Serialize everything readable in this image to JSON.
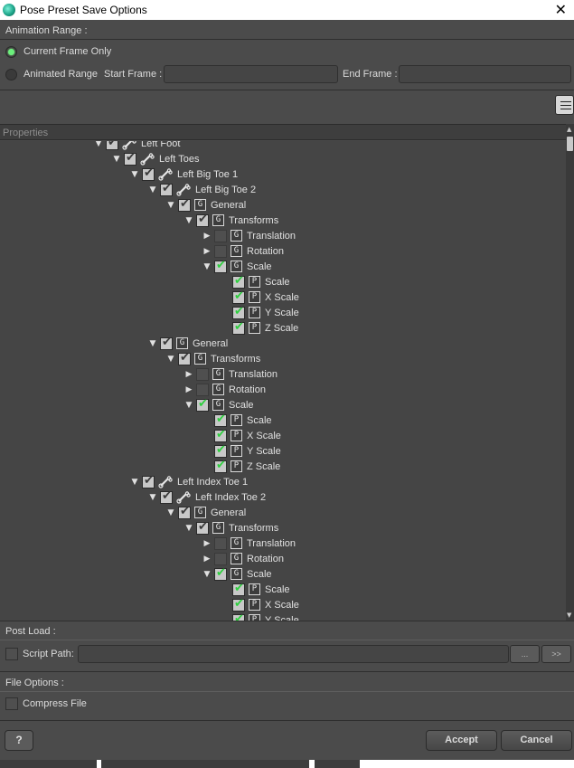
{
  "window": {
    "title": "Pose Preset Save Options",
    "close_glyph": "✕"
  },
  "animation_range": {
    "group_label": "Animation Range :",
    "current_frame_label": "Current Frame Only",
    "animated_range_label": "Animated Range",
    "start_frame_label": "Start Frame :",
    "end_frame_label": "End Frame :",
    "start_frame_value": "",
    "end_frame_value": ""
  },
  "properties": {
    "header": "Properties",
    "rows": [
      {
        "indent": 0,
        "arrow": "down",
        "check": "on",
        "icon": "bone",
        "label": "Left Foot"
      },
      {
        "indent": 1,
        "arrow": "down",
        "check": "on",
        "icon": "bone",
        "label": "Left Toes"
      },
      {
        "indent": 2,
        "arrow": "down",
        "check": "on",
        "icon": "bone",
        "label": "Left Big Toe 1"
      },
      {
        "indent": 3,
        "arrow": "down",
        "check": "on",
        "icon": "bone",
        "label": "Left Big Toe 2"
      },
      {
        "indent": 4,
        "arrow": "down",
        "check": "on",
        "icon": "G",
        "label": "General"
      },
      {
        "indent": 5,
        "arrow": "down",
        "check": "on",
        "icon": "G",
        "label": "Transforms"
      },
      {
        "indent": 6,
        "arrow": "right",
        "check": "off",
        "icon": "G",
        "label": "Translation"
      },
      {
        "indent": 6,
        "arrow": "right",
        "check": "off",
        "icon": "G",
        "label": "Rotation"
      },
      {
        "indent": 6,
        "arrow": "down",
        "check": "green",
        "icon": "G",
        "label": "Scale"
      },
      {
        "indent": 7,
        "arrow": "",
        "check": "green",
        "icon": "P",
        "label": "Scale"
      },
      {
        "indent": 7,
        "arrow": "",
        "check": "green",
        "icon": "P",
        "label": "X Scale"
      },
      {
        "indent": 7,
        "arrow": "",
        "check": "green",
        "icon": "P",
        "label": "Y Scale"
      },
      {
        "indent": 7,
        "arrow": "",
        "check": "green",
        "icon": "P",
        "label": "Z Scale"
      },
      {
        "indent": 3,
        "arrow": "down",
        "check": "on",
        "icon": "G",
        "label": "General"
      },
      {
        "indent": 4,
        "arrow": "down",
        "check": "on",
        "icon": "G",
        "label": "Transforms"
      },
      {
        "indent": 5,
        "arrow": "right",
        "check": "off",
        "icon": "G",
        "label": "Translation"
      },
      {
        "indent": 5,
        "arrow": "right",
        "check": "off",
        "icon": "G",
        "label": "Rotation"
      },
      {
        "indent": 5,
        "arrow": "down",
        "check": "green",
        "icon": "G",
        "label": "Scale"
      },
      {
        "indent": 6,
        "arrow": "",
        "check": "green",
        "icon": "P",
        "label": "Scale"
      },
      {
        "indent": 6,
        "arrow": "",
        "check": "green",
        "icon": "P",
        "label": "X Scale"
      },
      {
        "indent": 6,
        "arrow": "",
        "check": "green",
        "icon": "P",
        "label": "Y Scale"
      },
      {
        "indent": 6,
        "arrow": "",
        "check": "green",
        "icon": "P",
        "label": "Z Scale"
      },
      {
        "indent": 2,
        "arrow": "down",
        "check": "on",
        "icon": "bone",
        "label": "Left Index Toe 1"
      },
      {
        "indent": 3,
        "arrow": "down",
        "check": "on",
        "icon": "bone",
        "label": "Left Index Toe 2"
      },
      {
        "indent": 4,
        "arrow": "down",
        "check": "on",
        "icon": "G",
        "label": "General"
      },
      {
        "indent": 5,
        "arrow": "down",
        "check": "on",
        "icon": "G",
        "label": "Transforms"
      },
      {
        "indent": 6,
        "arrow": "right",
        "check": "off",
        "icon": "G",
        "label": "Translation"
      },
      {
        "indent": 6,
        "arrow": "right",
        "check": "off",
        "icon": "G",
        "label": "Rotation"
      },
      {
        "indent": 6,
        "arrow": "down",
        "check": "green",
        "icon": "G",
        "label": "Scale"
      },
      {
        "indent": 7,
        "arrow": "",
        "check": "green",
        "icon": "P",
        "label": "Scale"
      },
      {
        "indent": 7,
        "arrow": "",
        "check": "green",
        "icon": "P",
        "label": "X Scale"
      },
      {
        "indent": 7,
        "arrow": "",
        "check": "green",
        "icon": "P",
        "label": "Y Scale"
      }
    ]
  },
  "post_load": {
    "group_label": "Post Load :",
    "script_path_label": "Script Path:",
    "script_path_value": "",
    "browse_label": "...",
    "next_label": ">>"
  },
  "file_options": {
    "group_label": "File Options :",
    "compress_label": "Compress File"
  },
  "footer": {
    "help_label": "?",
    "accept_label": "Accept",
    "cancel_label": "Cancel"
  },
  "colors": {
    "panel_bg": "#4b4b4b",
    "tree_bg": "#454545",
    "check_green": "#2ecf3f",
    "radio_green": "#6bf07c"
  }
}
